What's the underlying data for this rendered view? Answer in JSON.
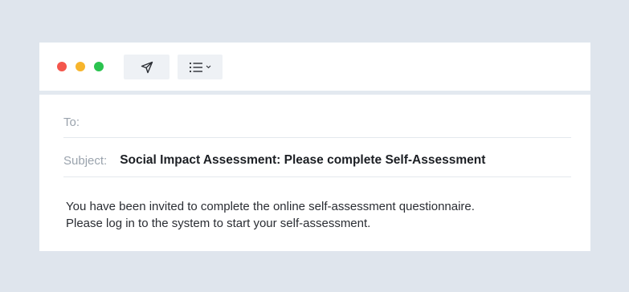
{
  "toolbar": {
    "window_controls": [
      "close",
      "minimize",
      "maximize"
    ],
    "send_icon": "send-icon",
    "list_icon": "list-icon"
  },
  "email": {
    "to_label": "To:",
    "to_value": "",
    "subject_label": "Subject:",
    "subject_value": "Social Impact Assessment: Please complete Self-Assessment",
    "body_line1": "You have been invited to complete the online self-assessment questionnaire.",
    "body_line2": "Please log in to the system to start your self-assessment."
  },
  "colors": {
    "background": "#dfe5ed",
    "close": "#f4564c",
    "minimize": "#f7b52c",
    "maximize": "#2bc34f"
  }
}
